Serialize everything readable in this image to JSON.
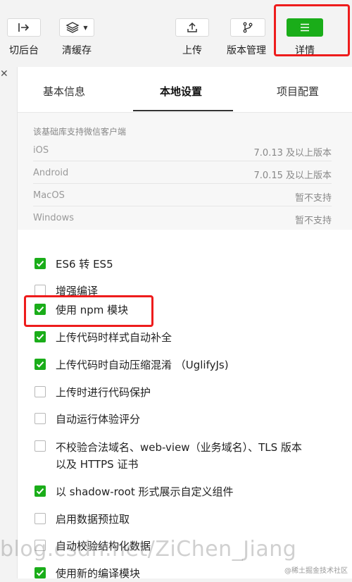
{
  "toolbar": {
    "items": [
      {
        "label": "切后台"
      },
      {
        "label": "清缓存"
      },
      {
        "label": "上传"
      },
      {
        "label": "版本管理"
      },
      {
        "label": "详情"
      }
    ]
  },
  "tabs": [
    {
      "label": "基本信息"
    },
    {
      "label": "本地设置"
    },
    {
      "label": "项目配置"
    }
  ],
  "info": {
    "title": "该基础库支持微信客户端",
    "rows": [
      {
        "platform": "iOS",
        "value": "7.0.13 及以上版本"
      },
      {
        "platform": "Android",
        "value": "7.0.15 及以上版本"
      },
      {
        "platform": "MacOS",
        "value": "暂不支持"
      },
      {
        "platform": "Windows",
        "value": "暂不支持"
      }
    ]
  },
  "options": [
    {
      "label": "ES6 转 ES5",
      "checked": true
    },
    {
      "label": "增强编译",
      "checked": false
    },
    {
      "label": "使用 npm 模块",
      "checked": true
    },
    {
      "label": "上传代码时样式自动补全",
      "checked": true
    },
    {
      "label": "上传代码时自动压缩混淆 （UglifyJs)",
      "checked": true
    },
    {
      "label": "上传时进行代码保护",
      "checked": false
    },
    {
      "label": "自动运行体验评分",
      "checked": false
    },
    {
      "label": "不校验合法域名、web-view（业务域名）、TLS 版本以及 HTTPS 证书",
      "checked": false
    },
    {
      "label": "以 shadow-root 形式展示自定义组件",
      "checked": true
    },
    {
      "label": "启用数据预拉取",
      "checked": false
    },
    {
      "label": "自动校验结构化数据",
      "checked": false
    },
    {
      "label": "使用新的编译模块",
      "checked": true
    }
  ],
  "watermark": "blog.csdn.net/ZiChen_Jiang",
  "credit": "@稀土掘金技术社区",
  "colors": {
    "accent": "#1aad19",
    "highlight": "#ee1c1c"
  }
}
